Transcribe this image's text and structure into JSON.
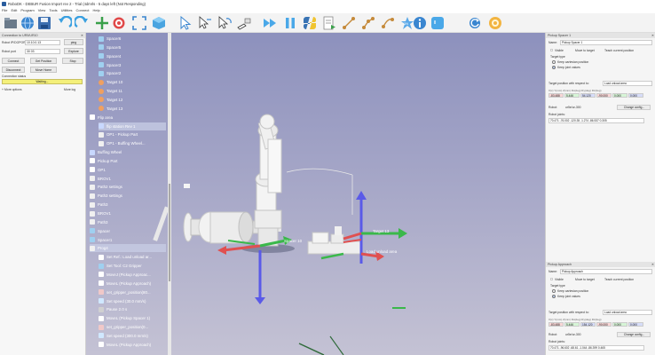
{
  "window": {
    "title": "RoboDK - DEBUR Fusion Import rev 2 - Trial (4dmrls - 5 days left (Not Responding)"
  },
  "menu": [
    "File",
    "Edit",
    "Program",
    "View",
    "Tools",
    "Utilities",
    "Connect",
    "Help"
  ],
  "toolbar": {
    "icons": [
      "open-icon",
      "globe-icon",
      "save-icon",
      "undo-icon",
      "redo-icon",
      "add-target-icon",
      "target-icon",
      "fit-icon",
      "cube-icon",
      "select-icon",
      "move-icon",
      "rotate-icon",
      "tool-icon",
      "fast-forward-icon",
      "pause-icon",
      "python-icon",
      "export-icon",
      "path-icon",
      "path2-icon",
      "path3-icon",
      "collision-icon",
      "info-icon",
      "sync-icon",
      "settings-icon"
    ]
  },
  "connection": {
    "header": "Connection to UR5/UR10",
    "robot_ip_label": "Robot IP/DOPOR",
    "robot_ip_value": "10.10.0.13",
    "ping_button": "ping",
    "robot_port_label": "Robot port",
    "robot_port_value": "30 03",
    "explore_button": "Explore",
    "connect_button": "Connect",
    "get_position_button": "Get Position",
    "stop_button": "Stop",
    "disconnect_button": "Disconnect",
    "move_home_button": "Move Home",
    "status_label": "Connection status",
    "status_value": "Waiting...",
    "more_options": "More options",
    "more_log": "More log"
  },
  "tree": {
    "items": [
      {
        "label": "Spacer6",
        "indent": 1,
        "icon": "spacer"
      },
      {
        "label": "Spacer5",
        "indent": 1,
        "icon": "spacer"
      },
      {
        "label": "Spacer4",
        "indent": 1,
        "icon": "spacer"
      },
      {
        "label": "Spacer3",
        "indent": 1,
        "icon": "spacer"
      },
      {
        "label": "Spacer2",
        "indent": 1,
        "icon": "spacer"
      },
      {
        "label": "Target 10",
        "indent": 1,
        "icon": "target"
      },
      {
        "label": "Target 11",
        "indent": 1,
        "icon": "target"
      },
      {
        "label": "Target 12",
        "indent": 1,
        "icon": "target"
      },
      {
        "label": "Target 13",
        "indent": 1,
        "icon": "target"
      },
      {
        "label": "Flip area",
        "indent": 0,
        "icon": "frame"
      },
      {
        "label": "flip station Rev 1",
        "indent": 1,
        "icon": "object",
        "selected": true
      },
      {
        "label": "OP1 - Pickup Part",
        "indent": 1,
        "icon": "program"
      },
      {
        "label": "OP1 - Buffing Wheel...",
        "indent": 1,
        "icon": "program"
      },
      {
        "label": "Buffing Wheel",
        "indent": 0,
        "icon": "object"
      },
      {
        "label": "Pickup Part",
        "indent": 0,
        "icon": "frame"
      },
      {
        "label": "OP1",
        "indent": 0,
        "icon": "frame"
      },
      {
        "label": "BROV1",
        "indent": 0,
        "icon": "program"
      },
      {
        "label": "Path2 settings",
        "indent": 0,
        "icon": "program"
      },
      {
        "label": "Path3 settings",
        "indent": 0,
        "icon": "program"
      },
      {
        "label": "Path3",
        "indent": 0,
        "icon": "program"
      },
      {
        "label": "BROV1",
        "indent": 0,
        "icon": "program"
      },
      {
        "label": "Path3",
        "indent": 0,
        "icon": "program"
      },
      {
        "label": "Spacer",
        "indent": 0,
        "icon": "spacer"
      },
      {
        "label": "Spacer1",
        "indent": 0,
        "icon": "spacer"
      },
      {
        "label": "Prog4",
        "indent": 0,
        "icon": "program",
        "selected": true
      },
      {
        "label": "Set Ref.: Load unload ar...",
        "indent": 1,
        "icon": "frame"
      },
      {
        "label": "Set Tool: C2 Gripper",
        "indent": 1,
        "icon": "tool"
      },
      {
        "label": "MoveJ (Pickup Approac...",
        "indent": 1,
        "icon": "move"
      },
      {
        "label": "MoveL (Pickup Approach)",
        "indent": 1,
        "icon": "move"
      },
      {
        "label": "set_gripper_position(80...",
        "indent": 1,
        "icon": "code"
      },
      {
        "label": "Set speed (30.0 mm/s)",
        "indent": 1,
        "icon": "speed"
      },
      {
        "label": "Pause 2.0 s",
        "indent": 1,
        "icon": "pause"
      },
      {
        "label": "MoveL (Pickup Spacer 1)",
        "indent": 1,
        "icon": "move"
      },
      {
        "label": "set_gripper_position(0...",
        "indent": 1,
        "icon": "code"
      },
      {
        "label": "Set speed (300.0 mm/s)",
        "indent": 1,
        "icon": "speed"
      },
      {
        "label": "MoveL (Pickup Approach)",
        "indent": 1,
        "icon": "move"
      }
    ]
  },
  "viewport": {
    "labels": {
      "target13": "Target 13",
      "spacer10": "Spacer 10",
      "load_area": "Load unload area"
    }
  },
  "pickup_spacer": {
    "header": "Pickup Spacer 1",
    "name_label": "Name:",
    "name_value": "Pickup Spacer 1",
    "visible": "Visible",
    "move_to_target": "Move to target",
    "teach_current": "Teach current position",
    "target_type": "Target type",
    "keep_cartesian": "Keep cartesian position",
    "keep_joint": "Keep joint values",
    "target_pos_label": "Target position with respect to:",
    "frame_value": "Load unload area",
    "pose_header": "X(c) Y(mm) Z(mm) Rx(deg) Ry(deg) Rz(deg)",
    "pose_values": [
      "-83.488",
      "5.446",
      "54.120",
      "-90.000",
      "0.000",
      "0.000"
    ],
    "robot_label": "Robot:",
    "robot_value": "ur5e/ur-300",
    "change_config": "Change config...",
    "joints_label": "Robot joints:",
    "joints_values": "70.471 -76.002 -120.35 -1.274 -86.537 0.305"
  },
  "pickup_approach": {
    "header": "Pickup Approach",
    "name_label": "Name:",
    "name_value": "Pickup Approach",
    "visible": "Visible",
    "move_to_target": "Move to target",
    "teach_current": "Teach current position",
    "target_type": "Target type",
    "keep_cartesian": "Keep cartesian position",
    "keep_joint": "Keep joint values",
    "target_pos_label": "Target position with respect to:",
    "frame_value": "Load unload area",
    "pose_header": "X(c) Y(mm) Z(mm) Rx(deg) Ry(deg) Rz(deg)",
    "pose_values": [
      "-83.488",
      "5.446",
      "154.120",
      "-90.000",
      "0.000",
      "0.000"
    ],
    "robot_label": "Robot:",
    "robot_value": "ur5e/ur-300",
    "change_config": "Change config...",
    "joints_label": "Robot joints:",
    "joints_values": "70.471 -96.602 -68.61 -1.044 -86.399 0.465"
  }
}
